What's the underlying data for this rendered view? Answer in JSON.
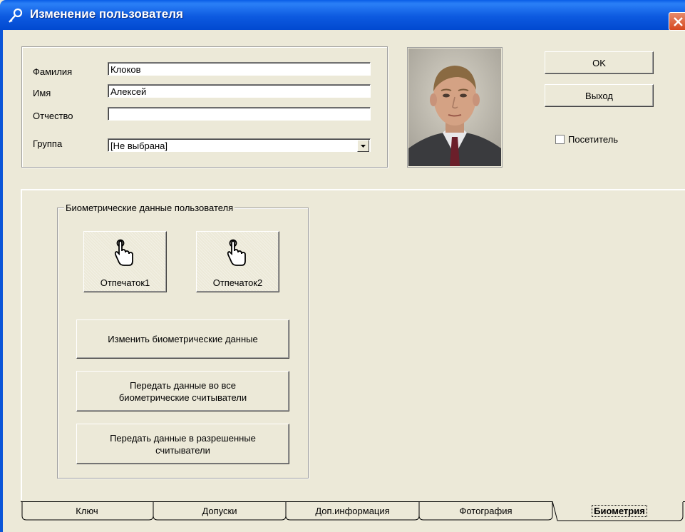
{
  "window": {
    "title": "Изменение пользователя"
  },
  "user": {
    "lastname_label": "Фамилия",
    "lastname_value": "Клоков",
    "firstname_label": "Имя",
    "firstname_value": "Алексей",
    "patronymic_label": "Отчество",
    "patronymic_value": "",
    "group_label": "Группа",
    "group_value": "[Не выбрана]"
  },
  "actions": {
    "ok_label": "OK",
    "exit_label": "Выход",
    "visitor_label": "Посетитель",
    "visitor_checked": false
  },
  "biometrics": {
    "group_title": "Биометрические данные пользователя",
    "fingerprint1_label": "Отпечаток1",
    "fingerprint2_label": "Отпечаток2",
    "change_button": "Изменить биометрические данные",
    "send_all_line1": "Передать данные во все",
    "send_all_line2": "биометрические считыватели",
    "send_allowed_line1": "Передать данные в разрешенные",
    "send_allowed_line2": "считыватели"
  },
  "tabs": [
    {
      "label": "Ключ",
      "active": false
    },
    {
      "label": "Допуски",
      "active": false
    },
    {
      "label": "Доп.информация",
      "active": false
    },
    {
      "label": "Фотография",
      "active": false
    },
    {
      "label": "Биометрия",
      "active": true
    }
  ],
  "icons": {
    "title_icon": "key-icon",
    "close_icon": "close-icon",
    "finger_icon": "pointing-hand-icon"
  },
  "colors": {
    "titlebar": "#0a5ee6",
    "window_bg": "#ece9d8",
    "close_button": "#d6471f"
  }
}
